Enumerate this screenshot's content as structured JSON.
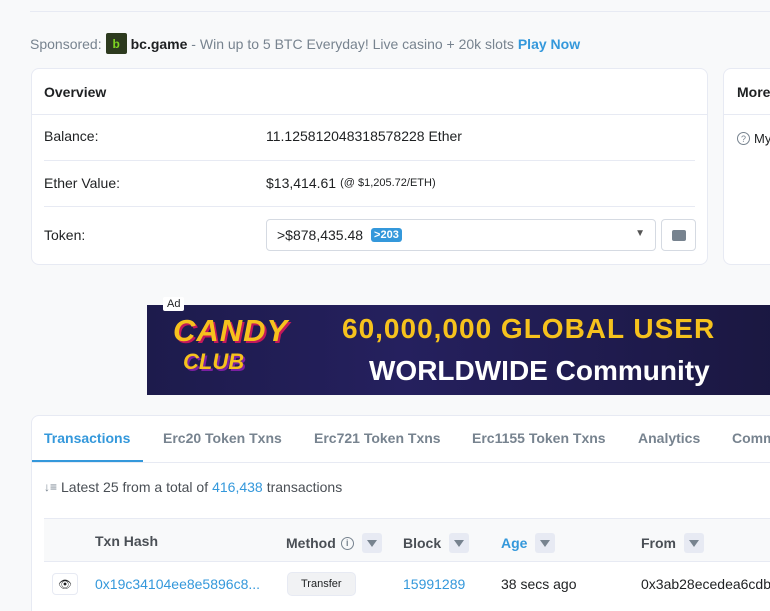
{
  "sponsor": {
    "prefix": "Sponsored:",
    "logo_letter": "b",
    "brand": "bc.game",
    "text": " - Win up to 5 BTC Everyday! Live casino + 20k slots",
    "cta": "Play Now"
  },
  "overview": {
    "title": "Overview",
    "balance_label": "Balance:",
    "balance_value": "11.125812048318578228 Ether",
    "ether_value_label": "Ether Value:",
    "ether_value": "$13,414.61",
    "ether_rate": "(@ $1,205.72/ETH)",
    "token_label": "Token:",
    "token_value": ">$878,435.48",
    "token_badge": ">203"
  },
  "more_info": {
    "title": "More",
    "item": "My"
  },
  "ad": {
    "tag": "Ad",
    "brand_top": "CANDY",
    "brand_bottom": "CLUB",
    "line1": "60,000,000 GLOBAL USER",
    "line2": "WORLDWIDE Community"
  },
  "tabs": [
    "Transactions",
    "Erc20 Token Txns",
    "Erc721 Token Txns",
    "Erc1155 Token Txns",
    "Analytics",
    "Comm"
  ],
  "summary": {
    "prefix": "Latest 25 from a total of",
    "count": "416,438",
    "suffix": "transactions"
  },
  "table": {
    "headers": {
      "hash": "Txn Hash",
      "method": "Method",
      "block": "Block",
      "age": "Age",
      "from": "From"
    },
    "rows": [
      {
        "hash": "0x19c34104ee8e5896c8...",
        "method": "Transfer",
        "block": "15991289",
        "age": "38 secs ago",
        "from": "0x3ab28ecedea6cdb"
      }
    ]
  },
  "colors": {
    "accent": "#3498db",
    "text": "#1e2022",
    "muted": "#77838f",
    "border": "#e7eaf3"
  }
}
